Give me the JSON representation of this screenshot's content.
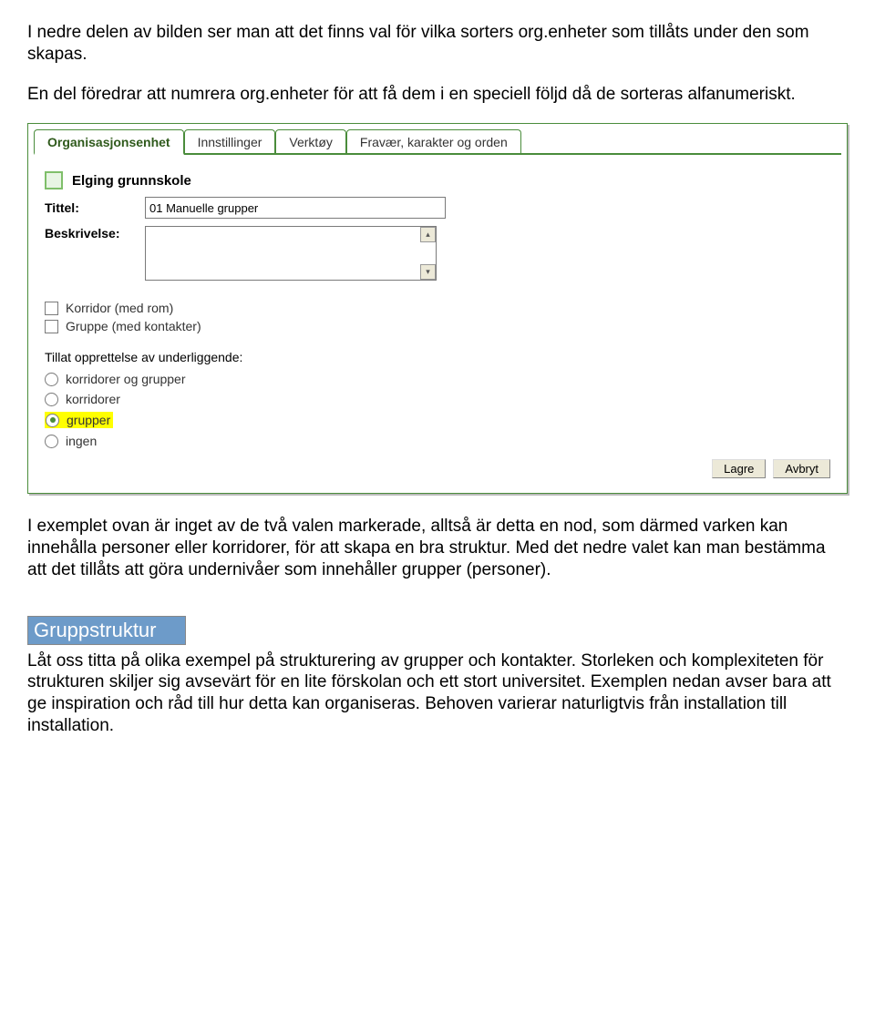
{
  "paragraphs": {
    "p1": "I nedre delen av bilden ser man att det finns val för vilka sorters org.enheter som tillåts under den som skapas.",
    "p2": "En del föredrar att numrera org.enheter för att få dem i en speciell följd då de sorteras alfanumeriskt.",
    "p3": "I exemplet ovan är inget av de två valen markerade, alltså är detta en nod, som därmed varken kan innehålla personer eller korridorer, för att skapa en bra struktur. Med det nedre valet kan man bestämma att det tillåts att göra undernivåer som innehåller grupper (personer).",
    "p4": "Låt oss titta på olika exempel på strukturering av grupper och kontakter. Storleken och komplexiteten för strukturen skiljer sig avsevärt för en lite förskolan och ett stort universitet. Exemplen nedan avser bara att ge inspiration och råd till hur detta kan organiseras. Behoven varierar naturligtvis från installation till installation."
  },
  "heading": "Gruppstruktur",
  "panel": {
    "tabs": [
      "Organisasjonsenhet",
      "Innstillinger",
      "Verktøy",
      "Fravær, karakter og orden"
    ],
    "activeTab": 0,
    "orgName": "Elging grunnskole",
    "titleLabel": "Tittel:",
    "titleValue": "01 Manuelle grupper",
    "descLabel": "Beskrivelse:",
    "checks": [
      "Korridor (med rom)",
      "Gruppe (med kontakter)"
    ],
    "radioHeading": "Tillat opprettelse av underliggende:",
    "radios": [
      "korridorer og grupper",
      "korridorer",
      "grupper",
      "ingen"
    ],
    "selectedRadio": 2,
    "buttons": {
      "save": "Lagre",
      "cancel": "Avbryt"
    }
  }
}
